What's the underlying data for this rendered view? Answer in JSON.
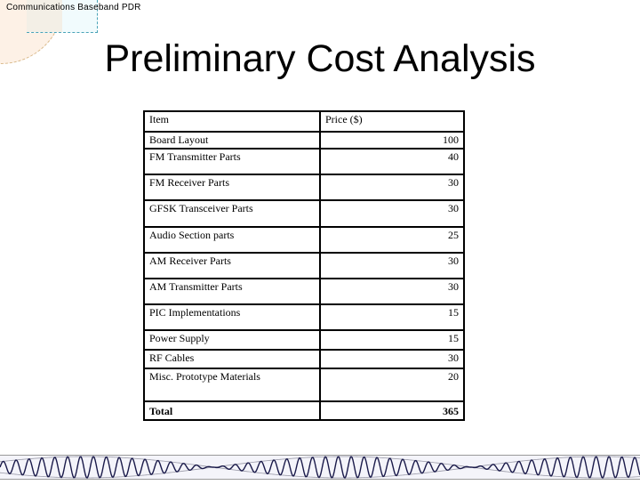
{
  "header": {
    "presentation_label": "Communications Baseband PDR"
  },
  "slide": {
    "title": "Preliminary Cost Analysis"
  },
  "table": {
    "columns": [
      "Item",
      "Price ($)"
    ],
    "rows": [
      {
        "item": "Board Layout",
        "price": "100"
      },
      {
        "item": "FM Transmitter Parts",
        "price": "40"
      },
      {
        "item": "FM Receiver Parts",
        "price": "30"
      },
      {
        "item": "GFSK Transceiver Parts",
        "price": "30"
      },
      {
        "item": "Audio Section parts",
        "price": "25"
      },
      {
        "item": "AM Receiver Parts",
        "price": "30"
      },
      {
        "item": "AM Transmitter Parts",
        "price": "30"
      },
      {
        "item": "PIC Implementations",
        "price": "15"
      },
      {
        "item": "Power Supply",
        "price": "15"
      },
      {
        "item": "RF Cables",
        "price": "30"
      },
      {
        "item": "Misc. Prototype Materials",
        "price": "20"
      }
    ],
    "total": {
      "item": "Total",
      "price": "365"
    }
  },
  "decoration": {
    "footer_graphic": "am-modulated-waveform",
    "wave_color": "#1a1a4a",
    "envelope_color": "#9a9aa8"
  }
}
